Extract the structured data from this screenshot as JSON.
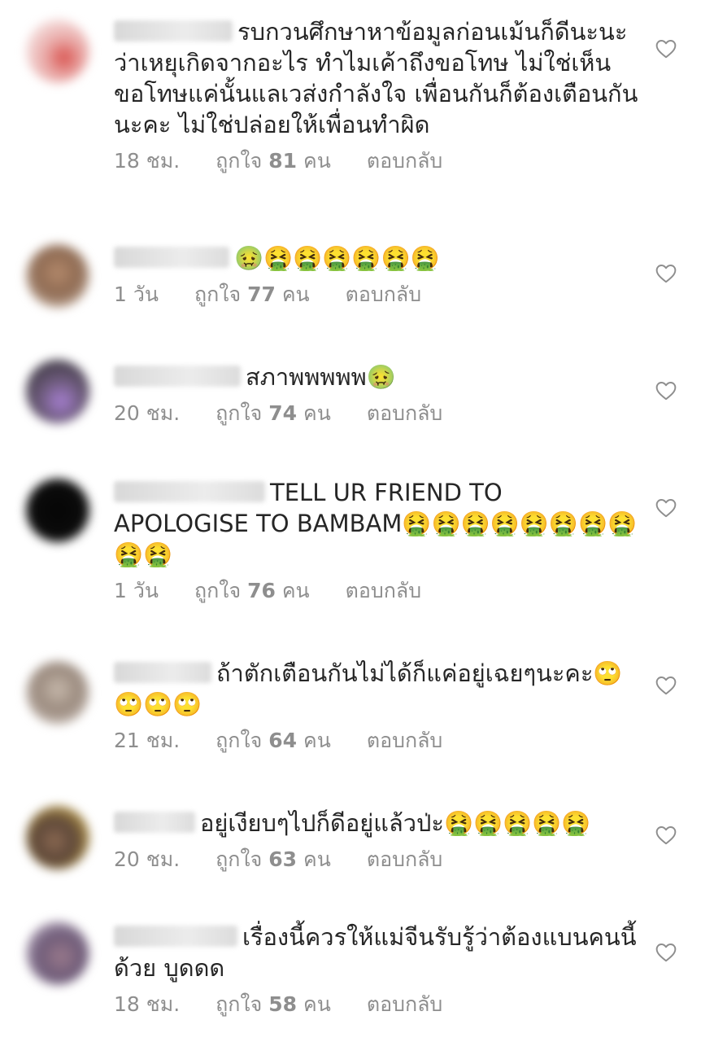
{
  "comments": [
    {
      "text": "รบกวนศึกษาหาข้อมูลก่อนเม้นก็ดีนะนะ ว่าเหยุเกิดจากอะไร ทำไมเค้าถึงขอโทษ ไม่ใช่เห็นขอโทษแค่นั้นแลเวส่งกำลังใจ เพื่อนกันก็ต้องเตือนกันนะคะ ไม่ใช่ปล่อยให้เพื่อนทำผิด",
      "time": "18 ชม.",
      "likes_prefix": "ถูกใจ",
      "likes_count": "81",
      "likes_suffix": "คน",
      "reply": "ตอบกลับ"
    },
    {
      "text": "🤢🤮🤮🤮🤮🤮🤮",
      "time": "1 วัน",
      "likes_prefix": "ถูกใจ",
      "likes_count": "77",
      "likes_suffix": "คน",
      "reply": "ตอบกลับ"
    },
    {
      "text": "สภาพพพพพ🤢",
      "time": "20 ชม.",
      "likes_prefix": "ถูกใจ",
      "likes_count": "74",
      "likes_suffix": "คน",
      "reply": "ตอบกลับ"
    },
    {
      "text": "TELL UR FRIEND TO APOLOGISE TO BAMBAM🤮🤮🤮🤮🤮🤮🤮🤮🤮🤮",
      "time": "1 วัน",
      "likes_prefix": "ถูกใจ",
      "likes_count": "76",
      "likes_suffix": "คน",
      "reply": "ตอบกลับ"
    },
    {
      "text": "ถ้าตักเตือนกันไม่ได้ก็แค่อยู่เฉยๆนะคะ🙄🙄🙄🙄",
      "time": "21 ชม.",
      "likes_prefix": "ถูกใจ",
      "likes_count": "64",
      "likes_suffix": "คน",
      "reply": "ตอบกลับ"
    },
    {
      "text": "อยู่เงียบๆไปก็ดีอยู่แล้วป่ะ🤮🤮🤮🤮🤮",
      "time": "20 ชม.",
      "likes_prefix": "ถูกใจ",
      "likes_count": "63",
      "likes_suffix": "คน",
      "reply": "ตอบกลับ"
    },
    {
      "text": "เรื่องนี้ควรให้แม่จีนรับรู้ว่าต้องแบนคนนี้ด้วย บูดดด",
      "time": "18 ชม.",
      "likes_prefix": "ถูกใจ",
      "likes_count": "58",
      "likes_suffix": "คน",
      "reply": "ตอบกลับ"
    }
  ],
  "heart_icon": "heart-outline-icon",
  "colors": {
    "text": "#262626",
    "meta": "#8e8e8e",
    "icon": "#8e8e8e"
  }
}
